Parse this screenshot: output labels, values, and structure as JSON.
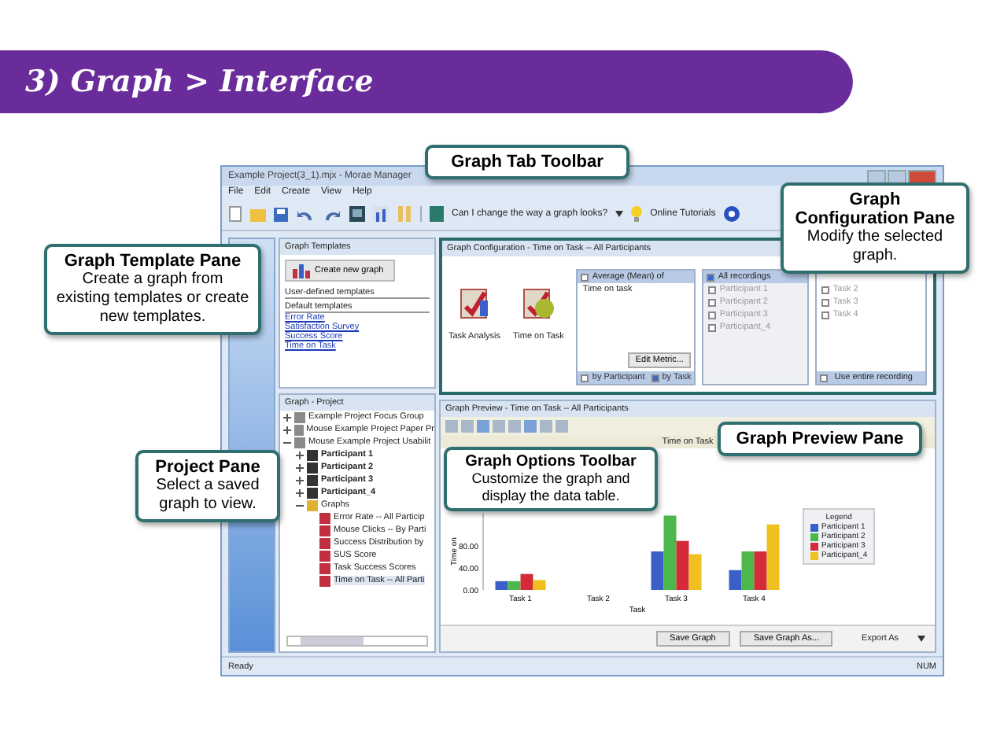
{
  "slide_title": "3) Graph > Interface",
  "window": {
    "title": "Example Project(3_1).mjx - Morae Manager",
    "menu": [
      "File",
      "Edit",
      "Create",
      "View",
      "Help"
    ],
    "toolbar": {
      "question": "Can I change the way a graph looks?",
      "tutorials": "Online Tutorials"
    }
  },
  "templates_pane": {
    "title": "Graph Templates",
    "create_button": "Create new graph",
    "user_heading": "User-defined templates",
    "default_heading": "Default templates",
    "items": [
      "Error Rate",
      "Satisfaction Survey",
      "Success Score",
      "Time on Task"
    ]
  },
  "project_pane": {
    "title": "Graph - Project",
    "tree": [
      {
        "label": "Example Project Focus Group",
        "kind": "project",
        "expanded": false,
        "selected": false
      },
      {
        "label": "Mouse Example Project Paper Pr",
        "kind": "project",
        "expanded": false,
        "selected": false
      },
      {
        "label": "Mouse Example Project Usabilit",
        "kind": "project",
        "expanded": true,
        "selected": false,
        "children": [
          {
            "label": "Participant 1",
            "kind": "participant",
            "expanded": false,
            "selected": false
          },
          {
            "label": "Participant 2",
            "kind": "participant",
            "expanded": false,
            "selected": false
          },
          {
            "label": "Participant 3",
            "kind": "participant",
            "expanded": false,
            "selected": false
          },
          {
            "label": "Participant_4",
            "kind": "participant",
            "expanded": false,
            "selected": false
          },
          {
            "label": "Graphs",
            "kind": "folder",
            "expanded": true,
            "selected": false,
            "children": [
              {
                "label": "Error Rate -- All Particip",
                "kind": "graph",
                "selected": false
              },
              {
                "label": "Mouse Clicks -- By Parti",
                "kind": "graph",
                "selected": false
              },
              {
                "label": "Success Distribution by",
                "kind": "graph",
                "selected": false
              },
              {
                "label": "SUS Score",
                "kind": "graph",
                "selected": false
              },
              {
                "label": "Task Success Scores",
                "kind": "graph",
                "selected": false
              },
              {
                "label": "Time on Task -- All Parti",
                "kind": "graph",
                "selected": true
              }
            ]
          }
        ]
      }
    ]
  },
  "config_pane": {
    "title": "Graph Configuration - Time on Task -- All Participants",
    "metrics": [
      "Task Analysis",
      "Time on Task"
    ],
    "measure": {
      "label": "Average (Mean) of",
      "checked": false
    },
    "measure_items": [
      "Time on task"
    ],
    "edit_button": "Edit Metric...",
    "grouping": [
      {
        "label": "by Participant",
        "selected": false
      },
      {
        "label": "by Task",
        "selected": true
      }
    ],
    "recordings": {
      "label": "All recordings",
      "checked": true
    },
    "participants": [
      {
        "label": "Participant 1",
        "checked": false
      },
      {
        "label": "Participant 2",
        "checked": false
      },
      {
        "label": "Participant 3",
        "checked": false
      },
      {
        "label": "Participant_4",
        "checked": false
      }
    ],
    "tasks": [
      {
        "label": "Task 2",
        "checked": false
      },
      {
        "label": "Task 3",
        "checked": false
      },
      {
        "label": "Task 4",
        "checked": false
      }
    ],
    "entire_recording": {
      "label": "Use entire recording",
      "checked": false
    }
  },
  "preview_pane": {
    "title": "Graph Preview - Time on Task -- All Participants",
    "chart_data": {
      "type": "bar",
      "title": "Time on Task",
      "xlabel": "Task",
      "ylabel": "Time on",
      "categories": [
        "Task 1",
        "Task 2",
        "Task 3",
        "Task 4"
      ],
      "series": [
        {
          "name": "Participant 1",
          "color": "#3a5fc8",
          "values": [
            16,
            null,
            70,
            36
          ]
        },
        {
          "name": "Participant 2",
          "color": "#4cb84c",
          "values": [
            16,
            null,
            135,
            70
          ]
        },
        {
          "name": "Participant 3",
          "color": "#d42a3a",
          "values": [
            29,
            null,
            89,
            70
          ]
        },
        {
          "name": "Participant_4",
          "color": "#f0c020",
          "values": [
            18,
            null,
            65,
            119
          ]
        }
      ],
      "ylim": [
        0,
        140
      ],
      "yticks": [
        {
          "value": 0,
          "label": "0.00"
        },
        {
          "value": 40,
          "label": "40.00"
        },
        {
          "value": 80,
          "label": "80.00"
        }
      ]
    },
    "legend_title": "Legend",
    "buttons": [
      "Save Graph",
      "Save Graph As..."
    ],
    "export": "Export As"
  },
  "status_bar": {
    "left": "Ready",
    "right": "NUM"
  },
  "callouts": [
    {
      "kind": "toolbar",
      "title": "Graph Tab Toolbar"
    },
    {
      "kind": "templates",
      "title": "Graph Template Pane",
      "text": "Create a graph from existing templates or create new templates."
    },
    {
      "kind": "config",
      "title": "Graph Configuration Pane",
      "text": "Modify the selected graph."
    },
    {
      "kind": "project",
      "title": "Project Pane",
      "text": "Select a saved graph to view."
    },
    {
      "kind": "options",
      "title": "Graph Options Toolbar",
      "text": "Customize the graph and display the data table."
    },
    {
      "kind": "preview",
      "title": "Graph Preview Pane"
    }
  ]
}
